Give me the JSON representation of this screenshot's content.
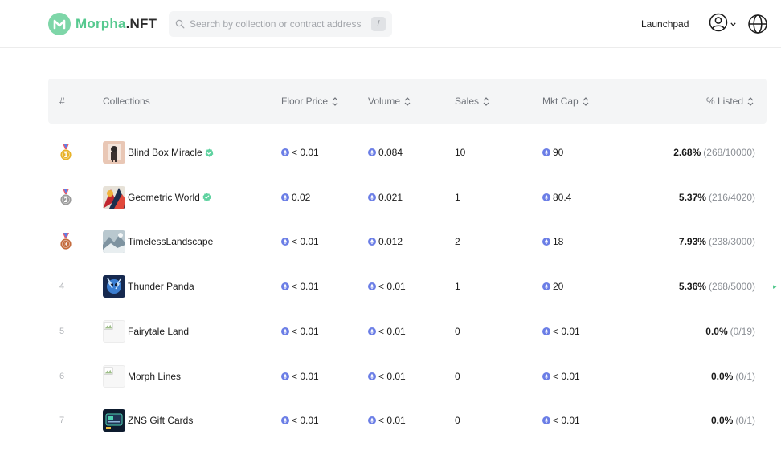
{
  "brand": {
    "name_part1": "Morpha",
    "name_part2": ".NFT"
  },
  "search": {
    "placeholder": "Search by collection or contract address",
    "shortcut": "/"
  },
  "nav": {
    "launchpad": "Launchpad"
  },
  "colors": {
    "accent": "#56c98f",
    "eth": "#6b7ee6",
    "verified": "#5fd2a0",
    "gold": "#e8b227",
    "silver": "#9a9a9a",
    "bronze": "#c46a3c"
  },
  "table": {
    "headers": {
      "rank": "#",
      "collections": "Collections",
      "floor": "Floor Price",
      "volume": "Volume",
      "sales": "Sales",
      "mktcap": "Mkt Cap",
      "listed": "% Listed"
    },
    "rows": [
      {
        "rank": "1",
        "medal": "gold",
        "name": "Blind Box Miracle",
        "verified": true,
        "floor": "< 0.01",
        "volume": "0.084",
        "sales": "10",
        "mktcap": "90",
        "listed_pct": "2.68%",
        "listed_frac": "(268/10000)"
      },
      {
        "rank": "2",
        "medal": "silver",
        "name": "Geometric World",
        "verified": true,
        "floor": "0.02",
        "volume": "0.021",
        "sales": "1",
        "mktcap": "80.4",
        "listed_pct": "5.37%",
        "listed_frac": "(216/4020)"
      },
      {
        "rank": "3",
        "medal": "bronze",
        "name": "TimelessLandscape",
        "verified": false,
        "floor": "< 0.01",
        "volume": "0.012",
        "sales": "2",
        "mktcap": "18",
        "listed_pct": "7.93%",
        "listed_frac": "(238/3000)"
      },
      {
        "rank": "4",
        "medal": "",
        "name": "Thunder Panda",
        "verified": false,
        "floor": "< 0.01",
        "volume": "< 0.01",
        "sales": "1",
        "mktcap": "20",
        "listed_pct": "5.36%",
        "listed_frac": "(268/5000)"
      },
      {
        "rank": "5",
        "medal": "",
        "name": "Fairytale Land",
        "verified": false,
        "floor": "< 0.01",
        "volume": "< 0.01",
        "sales": "0",
        "mktcap": "< 0.01",
        "listed_pct": "0.0%",
        "listed_frac": "(0/19)"
      },
      {
        "rank": "6",
        "medal": "",
        "name": "Morph Lines",
        "verified": false,
        "floor": "< 0.01",
        "volume": "< 0.01",
        "sales": "0",
        "mktcap": "< 0.01",
        "listed_pct": "0.0%",
        "listed_frac": "(0/1)"
      },
      {
        "rank": "7",
        "medal": "",
        "name": "ZNS Gift Cards",
        "verified": false,
        "floor": "< 0.01",
        "volume": "< 0.01",
        "sales": "0",
        "mktcap": "< 0.01",
        "listed_pct": "0.0%",
        "listed_frac": "(0/1)"
      }
    ]
  }
}
